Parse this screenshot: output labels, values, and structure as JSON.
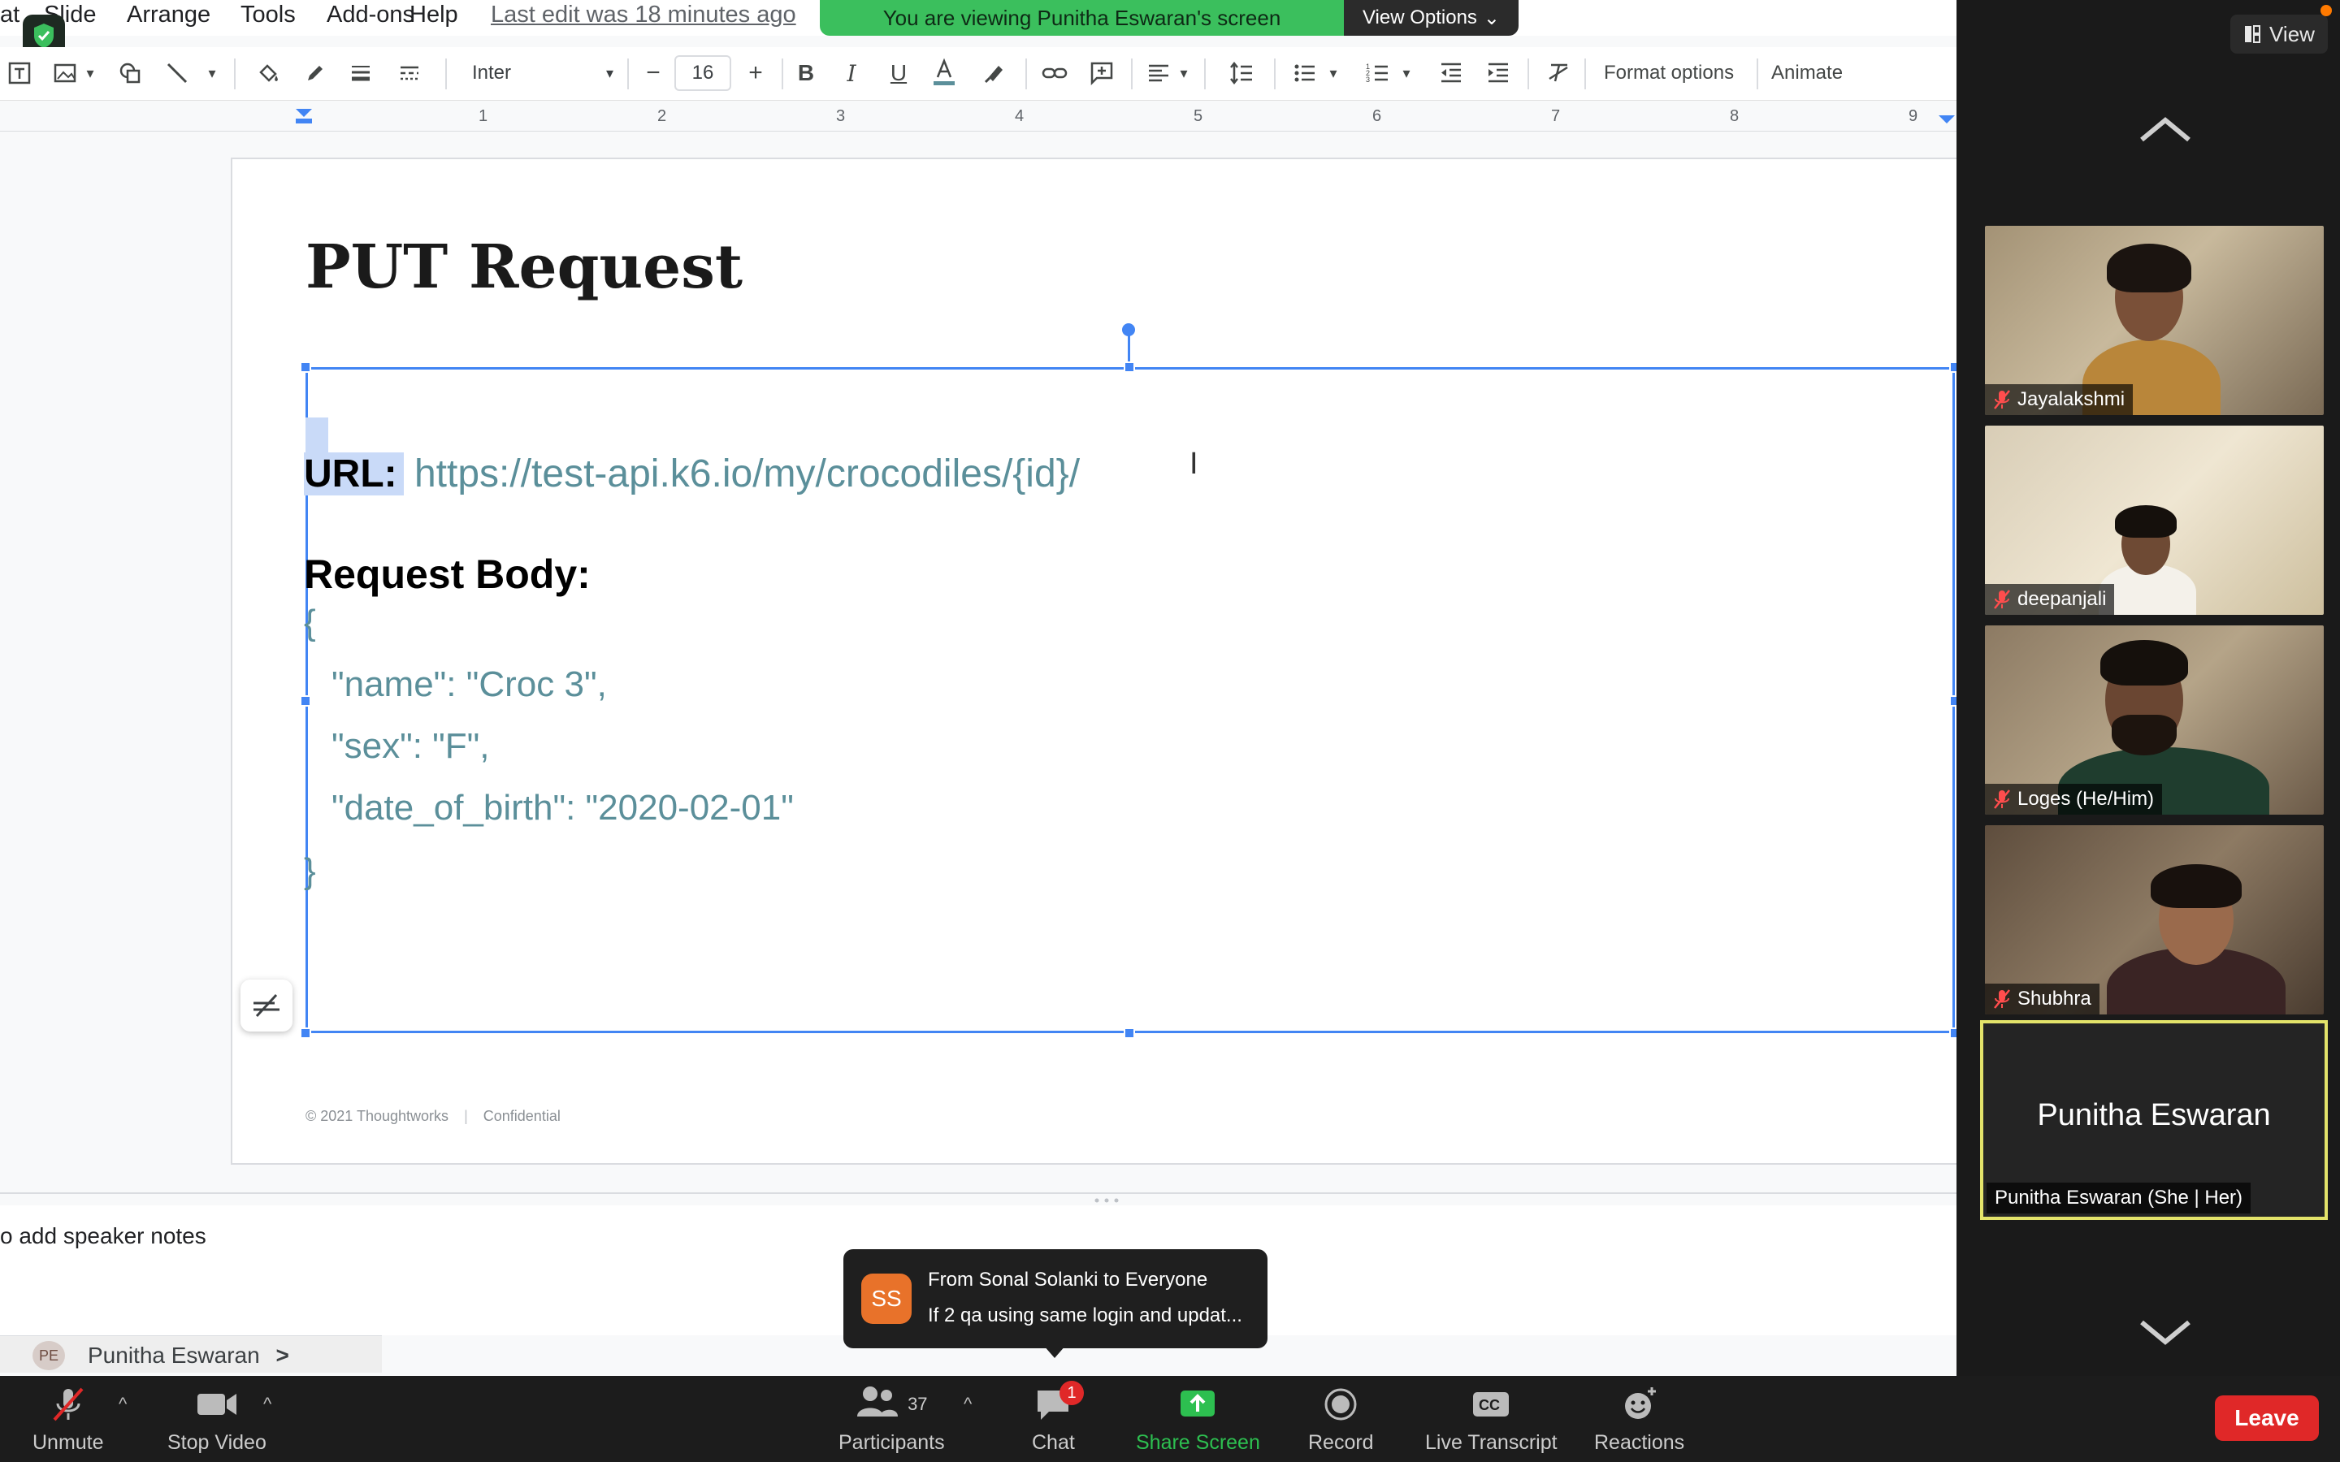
{
  "menubar": {
    "partial_item": "at",
    "items": [
      "Slide",
      "Arrange",
      "Tools",
      "Add-ons",
      "Help"
    ],
    "last_edit": "Last edit was 18 minutes ago"
  },
  "share_banner": {
    "text": "You are viewing Punitha Eswaran's screen",
    "view_options": "View Options"
  },
  "toolbar": {
    "font": "Inter",
    "font_size": "16",
    "format_options": "Format options",
    "animate": "Animate"
  },
  "ruler": {
    "marks": [
      "1",
      "2",
      "3",
      "4",
      "5",
      "6",
      "7",
      "8",
      "9"
    ]
  },
  "slide": {
    "title": "PUT Request",
    "url_label": "URL:",
    "url_value": "https://test-api.k6.io/my/crocodiles/{id}/",
    "body_label": "Request Body:",
    "json_lines": [
      "{",
      "\"name\": \"Croc 3\",",
      "\"sex\": \"F\",",
      "\"date_of_birth\": \"2020-02-01\"",
      "}"
    ],
    "footer_copyright": "© 2021 Thoughtworks",
    "footer_confidential": "Confidential"
  },
  "notes": {
    "placeholder": "o add speaker notes"
  },
  "presenter": {
    "initials": "PE",
    "name": "Punitha Eswaran",
    "chevron": ">"
  },
  "panel": {
    "view_label": "View",
    "participants": [
      {
        "name": "Jayalakshmi"
      },
      {
        "name": "deepanjali"
      },
      {
        "name": "Loges  (He/Him)"
      },
      {
        "name": "Shubhra"
      }
    ],
    "active_name": "Punitha Eswaran",
    "active_label": "Punitha Eswaran  (She | Her)"
  },
  "chat_toast": {
    "initials": "SS",
    "from": "From Sonal Solanki to Everyone",
    "message": "If 2 qa using same login and updat..."
  },
  "controls": {
    "unmute": "Unmute",
    "stop_video": "Stop Video",
    "participants": "Participants",
    "participant_count": "37",
    "chat": "Chat",
    "chat_badge": "1",
    "share_screen": "Share Screen",
    "record": "Record",
    "live_transcript": "Live Transcript",
    "reactions": "Reactions",
    "leave": "Leave",
    "caret": "^"
  },
  "colors": {
    "selection": "#4285f4",
    "code_text": "#5b8f9a",
    "share_green": "#3bbf5d",
    "leave_red": "#e02828",
    "active_border": "#e3e36a"
  }
}
